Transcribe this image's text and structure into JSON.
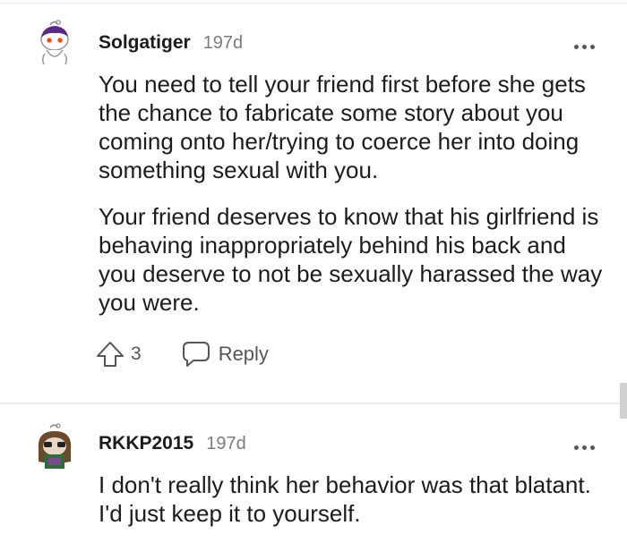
{
  "comments": [
    {
      "username": "Solgatiger",
      "age": "197d",
      "paragraphs": [
        "You need to tell your friend first before she gets the chance to fabricate some story about you coming onto her/trying to coerce her into doing something sexual with you.",
        "Your friend deserves to know that his girlfriend is behaving inappropriately behind his back and you deserve to not be sexually harassed the way you were."
      ],
      "votes": "3",
      "reply_label": "Reply"
    },
    {
      "username": "RKKP2015",
      "age": "197d",
      "paragraphs": [
        "I don't really think her behavior was that blatant. I'd just keep it to yourself."
      ]
    }
  ],
  "colors": {
    "text": "#1c1c1c",
    "muted": "#7c7c7c",
    "icon": "#555555",
    "divider": "#ececec"
  },
  "icons": [
    "snoo-avatar-icon",
    "more-options-icon",
    "upvote-icon",
    "reply-bubble-icon"
  ]
}
